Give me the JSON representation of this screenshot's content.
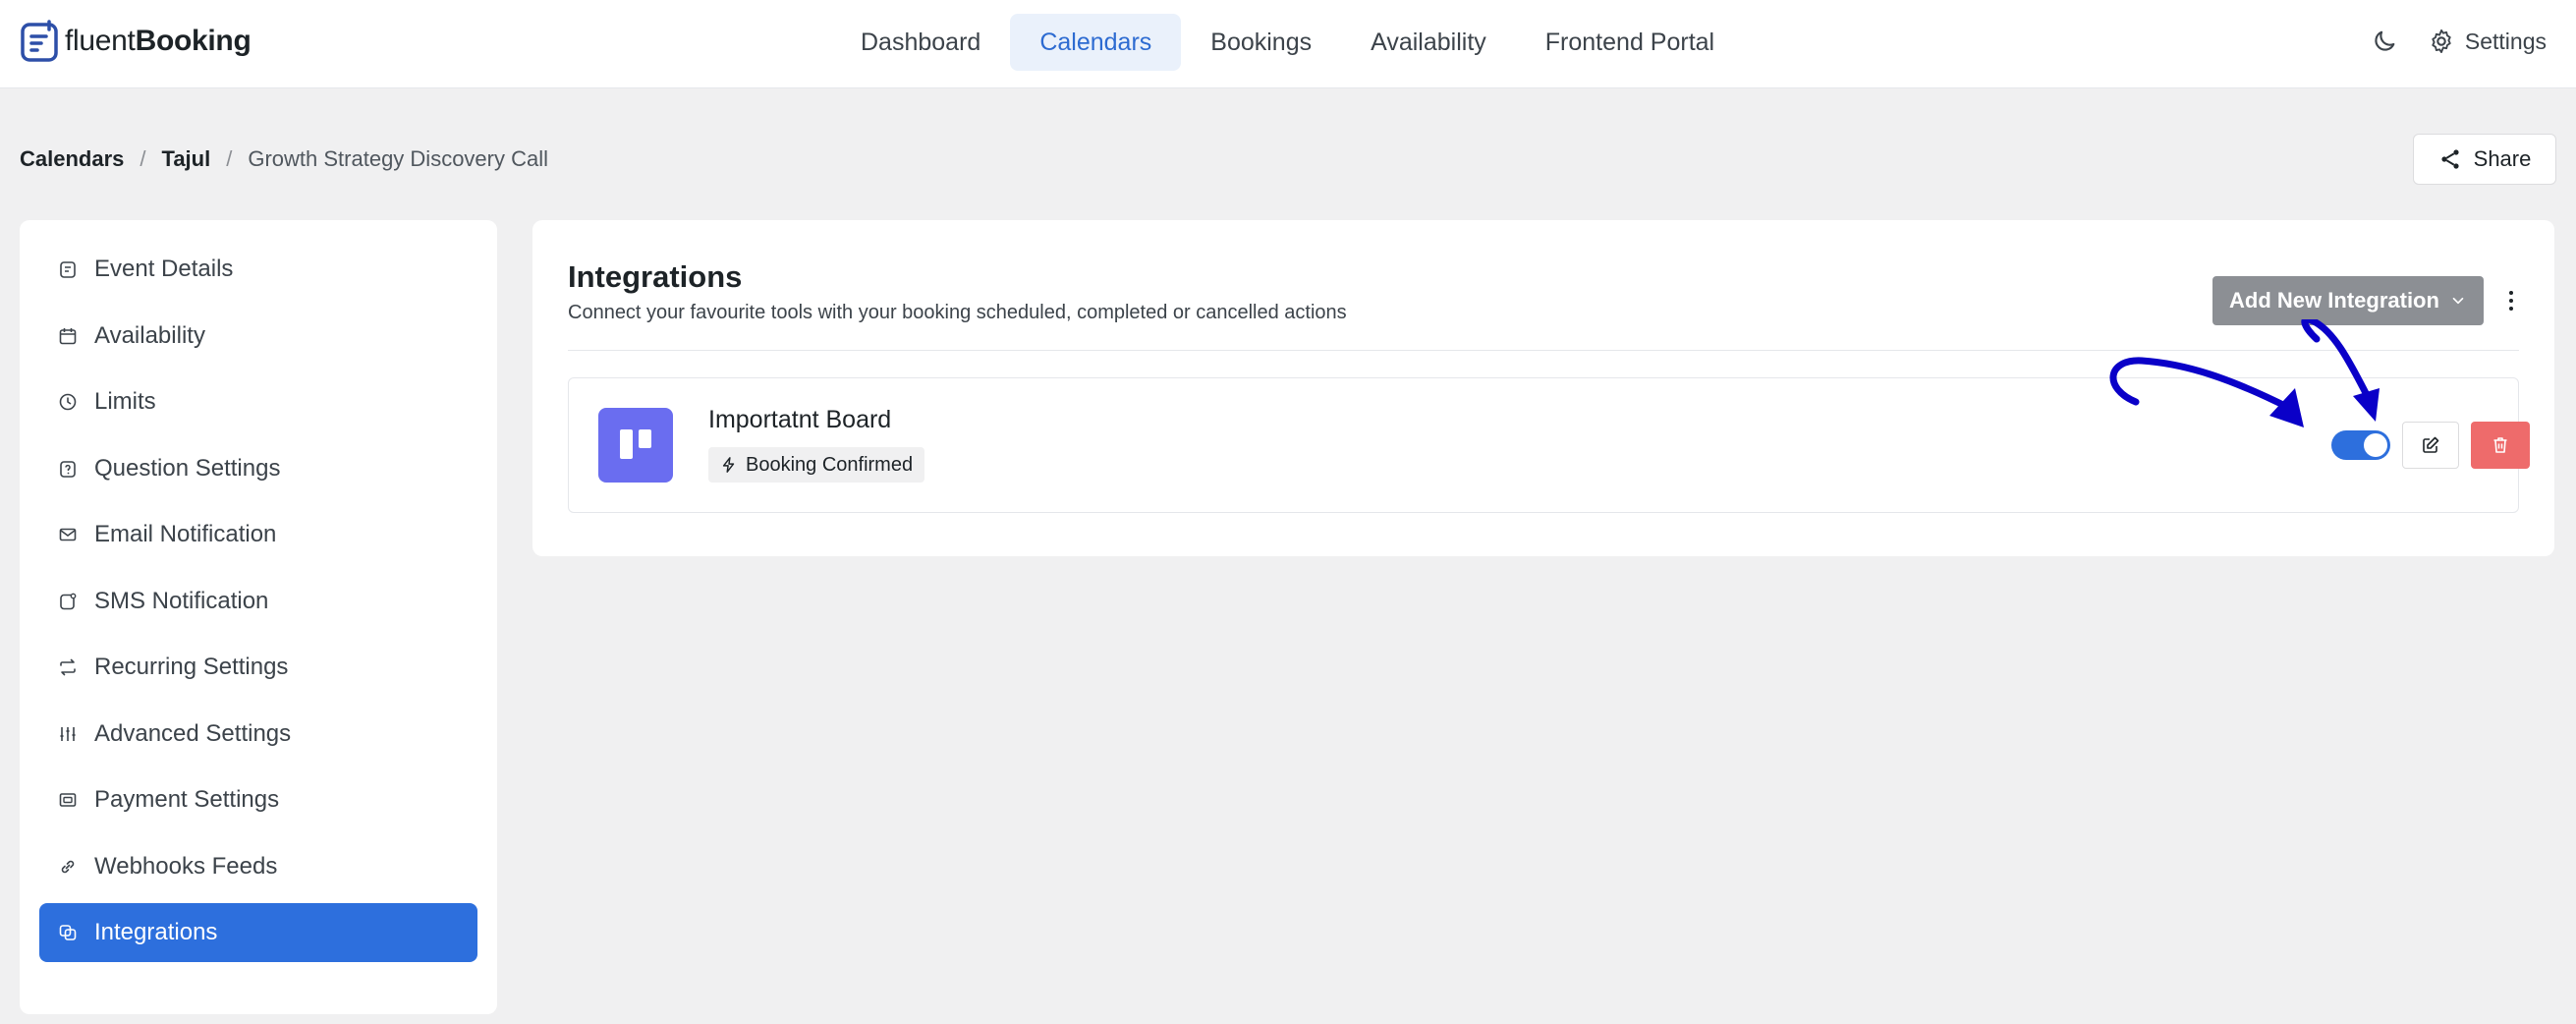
{
  "app": {
    "logo_light": "fluent",
    "logo_bold": "Booking"
  },
  "nav": {
    "items": [
      {
        "label": "Dashboard"
      },
      {
        "label": "Calendars",
        "active": true
      },
      {
        "label": "Bookings"
      },
      {
        "label": "Availability"
      },
      {
        "label": "Frontend Portal"
      }
    ],
    "theme_toggle_icon": "moon-icon",
    "settings_label": "Settings"
  },
  "breadcrumb": {
    "items": [
      "Calendars",
      "Tajul",
      "Growth Strategy Discovery Call"
    ]
  },
  "share_label": "Share",
  "sidebar": {
    "items": [
      {
        "label": "Event Details",
        "icon": "event-details-icon"
      },
      {
        "label": "Availability",
        "icon": "calendar-icon"
      },
      {
        "label": "Limits",
        "icon": "clock-icon"
      },
      {
        "label": "Question Settings",
        "icon": "question-icon"
      },
      {
        "label": "Email Notification",
        "icon": "mail-icon"
      },
      {
        "label": "SMS Notification",
        "icon": "sms-icon"
      },
      {
        "label": "Recurring Settings",
        "icon": "repeat-icon"
      },
      {
        "label": "Advanced Settings",
        "icon": "sliders-icon"
      },
      {
        "label": "Payment Settings",
        "icon": "payment-icon"
      },
      {
        "label": "Webhooks Feeds",
        "icon": "link-icon"
      },
      {
        "label": "Integrations",
        "icon": "integrations-icon",
        "active": true
      }
    ]
  },
  "main": {
    "title": "Integrations",
    "subtitle": "Connect your favourite tools with your booking scheduled, completed or cancelled actions",
    "add_button_label": "Add New Integration",
    "integration": {
      "name": "Importatnt Board",
      "trigger": "Booking Confirmed",
      "enabled": true
    }
  },
  "colors": {
    "accent": "#2d6fdd",
    "nav_active_bg": "#eaf1fb",
    "add_button_bg": "#8c8f94",
    "delete_bg": "#ee6b6b",
    "integration_logo_bg": "#6a6df0",
    "annotation_arrows": "#0a00c8"
  }
}
